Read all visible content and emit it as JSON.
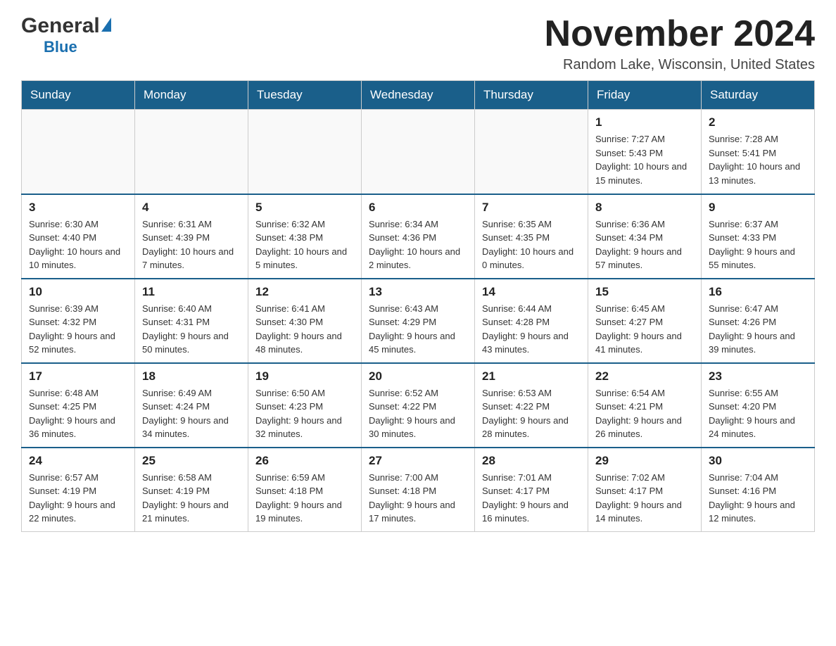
{
  "logo": {
    "general": "General",
    "blue": "Blue"
  },
  "title": {
    "month_year": "November 2024",
    "location": "Random Lake, Wisconsin, United States"
  },
  "days_of_week": [
    "Sunday",
    "Monday",
    "Tuesday",
    "Wednesday",
    "Thursday",
    "Friday",
    "Saturday"
  ],
  "weeks": [
    [
      {
        "day": "",
        "info": ""
      },
      {
        "day": "",
        "info": ""
      },
      {
        "day": "",
        "info": ""
      },
      {
        "day": "",
        "info": ""
      },
      {
        "day": "",
        "info": ""
      },
      {
        "day": "1",
        "info": "Sunrise: 7:27 AM\nSunset: 5:43 PM\nDaylight: 10 hours and 15 minutes."
      },
      {
        "day": "2",
        "info": "Sunrise: 7:28 AM\nSunset: 5:41 PM\nDaylight: 10 hours and 13 minutes."
      }
    ],
    [
      {
        "day": "3",
        "info": "Sunrise: 6:30 AM\nSunset: 4:40 PM\nDaylight: 10 hours and 10 minutes."
      },
      {
        "day": "4",
        "info": "Sunrise: 6:31 AM\nSunset: 4:39 PM\nDaylight: 10 hours and 7 minutes."
      },
      {
        "day": "5",
        "info": "Sunrise: 6:32 AM\nSunset: 4:38 PM\nDaylight: 10 hours and 5 minutes."
      },
      {
        "day": "6",
        "info": "Sunrise: 6:34 AM\nSunset: 4:36 PM\nDaylight: 10 hours and 2 minutes."
      },
      {
        "day": "7",
        "info": "Sunrise: 6:35 AM\nSunset: 4:35 PM\nDaylight: 10 hours and 0 minutes."
      },
      {
        "day": "8",
        "info": "Sunrise: 6:36 AM\nSunset: 4:34 PM\nDaylight: 9 hours and 57 minutes."
      },
      {
        "day": "9",
        "info": "Sunrise: 6:37 AM\nSunset: 4:33 PM\nDaylight: 9 hours and 55 minutes."
      }
    ],
    [
      {
        "day": "10",
        "info": "Sunrise: 6:39 AM\nSunset: 4:32 PM\nDaylight: 9 hours and 52 minutes."
      },
      {
        "day": "11",
        "info": "Sunrise: 6:40 AM\nSunset: 4:31 PM\nDaylight: 9 hours and 50 minutes."
      },
      {
        "day": "12",
        "info": "Sunrise: 6:41 AM\nSunset: 4:30 PM\nDaylight: 9 hours and 48 minutes."
      },
      {
        "day": "13",
        "info": "Sunrise: 6:43 AM\nSunset: 4:29 PM\nDaylight: 9 hours and 45 minutes."
      },
      {
        "day": "14",
        "info": "Sunrise: 6:44 AM\nSunset: 4:28 PM\nDaylight: 9 hours and 43 minutes."
      },
      {
        "day": "15",
        "info": "Sunrise: 6:45 AM\nSunset: 4:27 PM\nDaylight: 9 hours and 41 minutes."
      },
      {
        "day": "16",
        "info": "Sunrise: 6:47 AM\nSunset: 4:26 PM\nDaylight: 9 hours and 39 minutes."
      }
    ],
    [
      {
        "day": "17",
        "info": "Sunrise: 6:48 AM\nSunset: 4:25 PM\nDaylight: 9 hours and 36 minutes."
      },
      {
        "day": "18",
        "info": "Sunrise: 6:49 AM\nSunset: 4:24 PM\nDaylight: 9 hours and 34 minutes."
      },
      {
        "day": "19",
        "info": "Sunrise: 6:50 AM\nSunset: 4:23 PM\nDaylight: 9 hours and 32 minutes."
      },
      {
        "day": "20",
        "info": "Sunrise: 6:52 AM\nSunset: 4:22 PM\nDaylight: 9 hours and 30 minutes."
      },
      {
        "day": "21",
        "info": "Sunrise: 6:53 AM\nSunset: 4:22 PM\nDaylight: 9 hours and 28 minutes."
      },
      {
        "day": "22",
        "info": "Sunrise: 6:54 AM\nSunset: 4:21 PM\nDaylight: 9 hours and 26 minutes."
      },
      {
        "day": "23",
        "info": "Sunrise: 6:55 AM\nSunset: 4:20 PM\nDaylight: 9 hours and 24 minutes."
      }
    ],
    [
      {
        "day": "24",
        "info": "Sunrise: 6:57 AM\nSunset: 4:19 PM\nDaylight: 9 hours and 22 minutes."
      },
      {
        "day": "25",
        "info": "Sunrise: 6:58 AM\nSunset: 4:19 PM\nDaylight: 9 hours and 21 minutes."
      },
      {
        "day": "26",
        "info": "Sunrise: 6:59 AM\nSunset: 4:18 PM\nDaylight: 9 hours and 19 minutes."
      },
      {
        "day": "27",
        "info": "Sunrise: 7:00 AM\nSunset: 4:18 PM\nDaylight: 9 hours and 17 minutes."
      },
      {
        "day": "28",
        "info": "Sunrise: 7:01 AM\nSunset: 4:17 PM\nDaylight: 9 hours and 16 minutes."
      },
      {
        "day": "29",
        "info": "Sunrise: 7:02 AM\nSunset: 4:17 PM\nDaylight: 9 hours and 14 minutes."
      },
      {
        "day": "30",
        "info": "Sunrise: 7:04 AM\nSunset: 4:16 PM\nDaylight: 9 hours and 12 minutes."
      }
    ]
  ]
}
